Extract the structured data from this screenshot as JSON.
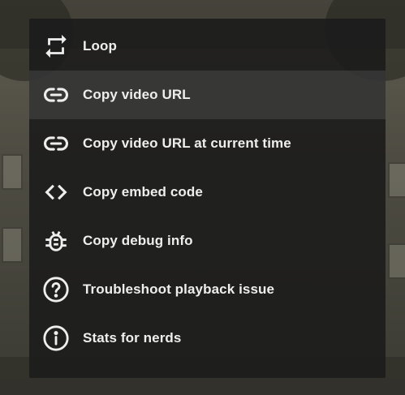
{
  "context_menu": {
    "items": [
      {
        "label": "Loop",
        "icon": "loop-icon"
      },
      {
        "label": "Copy video URL",
        "icon": "link-icon",
        "hovered": true
      },
      {
        "label": "Copy video URL at current time",
        "icon": "link-icon"
      },
      {
        "label": "Copy embed code",
        "icon": "code-brackets-icon"
      },
      {
        "label": "Copy debug info",
        "icon": "bug-icon"
      },
      {
        "label": "Troubleshoot playback issue",
        "icon": "question-circle-icon"
      },
      {
        "label": "Stats for nerds",
        "icon": "info-circle-icon"
      }
    ]
  },
  "colors": {
    "menu_background": "#1c1c1c",
    "text": "#eeeeee",
    "hover_background": "#3a3a3a"
  }
}
